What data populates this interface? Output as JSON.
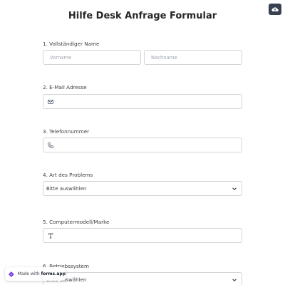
{
  "header": {
    "title": "Hilfe Desk Anfrage Formular",
    "cloud_icon": "cloud-upload-icon"
  },
  "fields": {
    "name": {
      "label": "1. Vollständiger Name",
      "first_placeholder": "Vorname",
      "last_placeholder": "Nachname"
    },
    "email": {
      "label": "2. E-Mail Adresse",
      "icon": "mail-icon",
      "value": ""
    },
    "phone": {
      "label": "3. Telefonnummer",
      "icon": "phone-icon",
      "value": ""
    },
    "problem": {
      "label": "4. Art des Problems",
      "selected": "Bitte auswählen"
    },
    "computer": {
      "label": "5. Computermodell/Marke",
      "icon": "text-icon",
      "value": ""
    },
    "os": {
      "label": "6. Betriebssystem",
      "selected": "Bitte auswählen"
    }
  },
  "badge": {
    "prefix": "Made with",
    "brand": "forms.app"
  },
  "colors": {
    "accent": "#374151",
    "border": "#d4d4d8",
    "brand": "#6d28d9"
  }
}
